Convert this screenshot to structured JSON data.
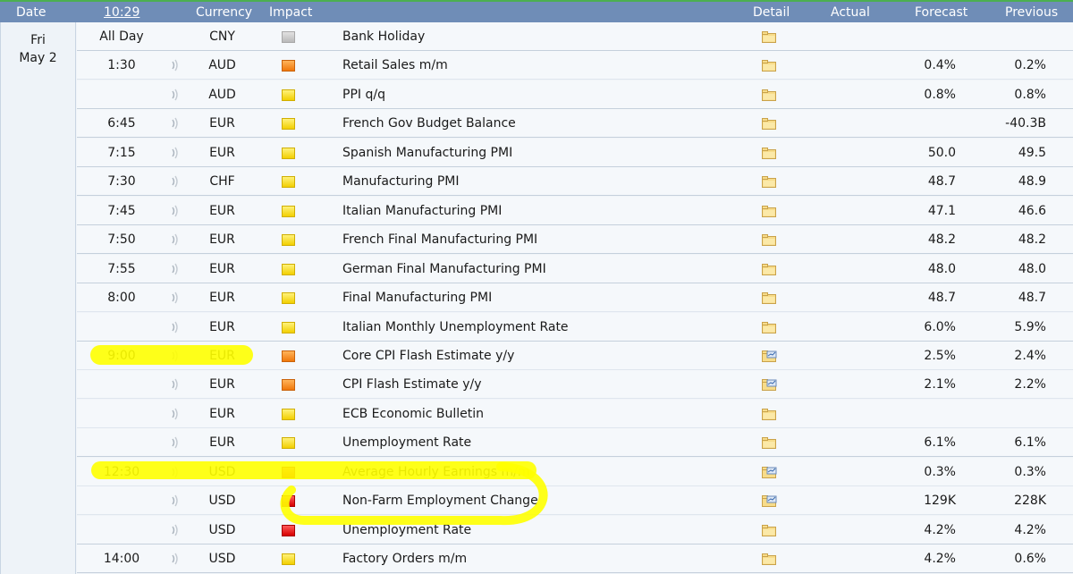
{
  "header": {
    "date": "Date",
    "time": "10:29",
    "currency": "Currency",
    "impact": "Impact",
    "detail": "Detail",
    "actual": "Actual",
    "forecast": "Forecast",
    "previous": "Previous"
  },
  "date": {
    "day": "Fri",
    "date": "May 2"
  },
  "colors": {
    "header_bg": "#6f8db7",
    "highlighter": "#ffff00",
    "row_bg": "#f5f8fb"
  },
  "rows": [
    {
      "time": "All Day",
      "currency": "CNY",
      "impact": "gray",
      "event": "Bank Holiday",
      "detail_icon": "folder-icon",
      "forecast": "",
      "previous": ""
    },
    {
      "time": "1:30",
      "currency": "AUD",
      "impact": "orange",
      "event": "Retail Sales m/m",
      "detail_icon": "folder-icon",
      "forecast": "0.4%",
      "previous": "0.2%"
    },
    {
      "time": "",
      "currency": "AUD",
      "impact": "yellow",
      "event": "PPI q/q",
      "detail_icon": "folder-icon",
      "forecast": "0.8%",
      "previous": "0.8%"
    },
    {
      "time": "6:45",
      "currency": "EUR",
      "impact": "yellow",
      "event": "French Gov Budget Balance",
      "detail_icon": "folder-icon",
      "forecast": "",
      "previous": "-40.3B"
    },
    {
      "time": "7:15",
      "currency": "EUR",
      "impact": "yellow",
      "event": "Spanish Manufacturing PMI",
      "detail_icon": "folder-icon",
      "forecast": "50.0",
      "previous": "49.5"
    },
    {
      "time": "7:30",
      "currency": "CHF",
      "impact": "yellow",
      "event": "Manufacturing PMI",
      "detail_icon": "folder-icon",
      "forecast": "48.7",
      "previous": "48.9"
    },
    {
      "time": "7:45",
      "currency": "EUR",
      "impact": "yellow",
      "event": "Italian Manufacturing PMI",
      "detail_icon": "folder-icon",
      "forecast": "47.1",
      "previous": "46.6"
    },
    {
      "time": "7:50",
      "currency": "EUR",
      "impact": "yellow",
      "event": "French Final Manufacturing PMI",
      "detail_icon": "folder-icon",
      "forecast": "48.2",
      "previous": "48.2"
    },
    {
      "time": "7:55",
      "currency": "EUR",
      "impact": "yellow",
      "event": "German Final Manufacturing PMI",
      "detail_icon": "folder-icon",
      "forecast": "48.0",
      "previous": "48.0"
    },
    {
      "time": "8:00",
      "currency": "EUR",
      "impact": "yellow",
      "event": "Final Manufacturing PMI",
      "detail_icon": "folder-icon",
      "forecast": "48.7",
      "previous": "48.7"
    },
    {
      "time": "",
      "currency": "EUR",
      "impact": "yellow",
      "event": "Italian Monthly Unemployment Rate",
      "detail_icon": "folder-icon",
      "forecast": "6.0%",
      "previous": "5.9%"
    },
    {
      "time": "9:00",
      "currency": "EUR",
      "impact": "orange",
      "event": "Core CPI Flash Estimate y/y",
      "detail_icon": "folder-chart-icon",
      "forecast": "2.5%",
      "previous": "2.4%"
    },
    {
      "time": "",
      "currency": "EUR",
      "impact": "orange",
      "event": "CPI Flash Estimate y/y",
      "detail_icon": "folder-chart-icon",
      "forecast": "2.1%",
      "previous": "2.2%"
    },
    {
      "time": "",
      "currency": "EUR",
      "impact": "yellow",
      "event": "ECB Economic Bulletin",
      "detail_icon": "folder-icon",
      "forecast": "",
      "previous": ""
    },
    {
      "time": "",
      "currency": "EUR",
      "impact": "yellow",
      "event": "Unemployment Rate",
      "detail_icon": "folder-icon",
      "forecast": "6.1%",
      "previous": "6.1%"
    },
    {
      "time": "12:30",
      "currency": "USD",
      "impact": "red",
      "event": "Average Hourly Earnings m/m",
      "detail_icon": "folder-chart-icon",
      "forecast": "0.3%",
      "previous": "0.3%"
    },
    {
      "time": "",
      "currency": "USD",
      "impact": "red",
      "event": "Non-Farm Employment Change",
      "detail_icon": "folder-chart-icon",
      "forecast": "129K",
      "previous": "228K"
    },
    {
      "time": "",
      "currency": "USD",
      "impact": "red",
      "event": "Unemployment Rate",
      "detail_icon": "folder-icon",
      "forecast": "4.2%",
      "previous": "4.2%"
    },
    {
      "time": "14:00",
      "currency": "USD",
      "impact": "yellow",
      "event": "Factory Orders m/m",
      "detail_icon": "folder-icon",
      "forecast": "4.2%",
      "previous": "0.6%"
    }
  ]
}
